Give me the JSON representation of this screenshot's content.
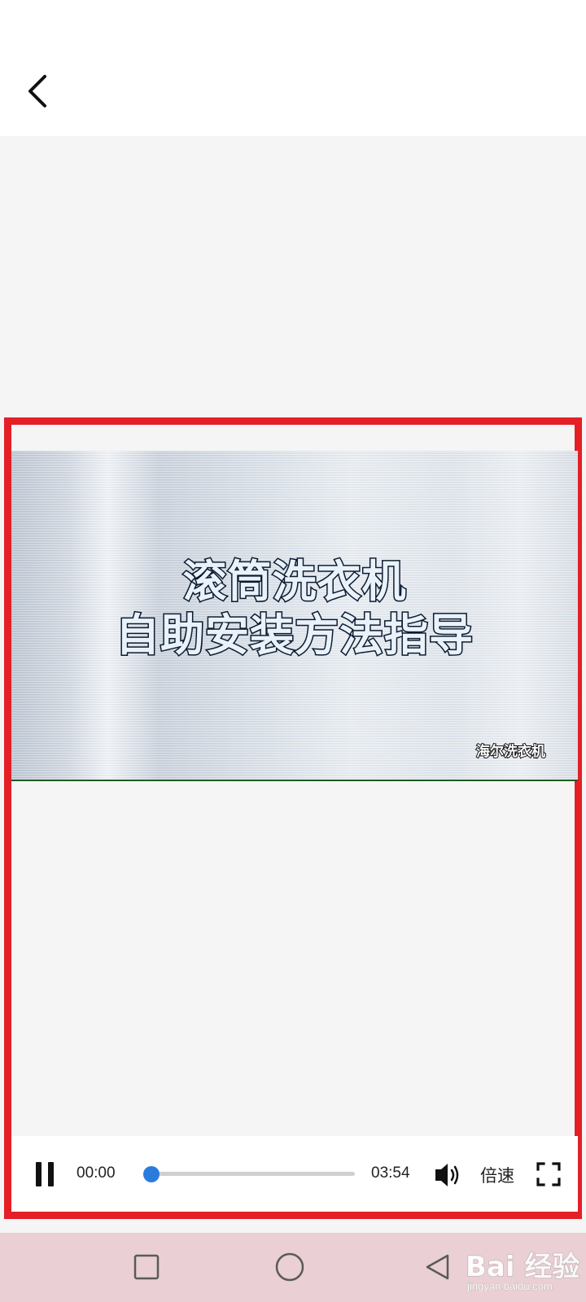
{
  "video": {
    "title_line1": "滚筒洗衣机",
    "title_line2": "自助安装方法指导",
    "brand": "海尔洗衣机"
  },
  "controls": {
    "current_time": "00:00",
    "total_time": "03:54",
    "progress": 0.0,
    "speed_label": "倍速",
    "accent_color": "#2b7bdc"
  },
  "highlight_color": "#e41f26",
  "watermark": {
    "logo_text": "Bai 经验",
    "url": "jingyan.baidu.com"
  },
  "icons": {
    "back": "chevron-left",
    "pause": "pause",
    "volume": "speaker",
    "fullscreen": "fullscreen-corners",
    "recents": "square",
    "home": "circle",
    "back_nav": "triangle-left"
  }
}
